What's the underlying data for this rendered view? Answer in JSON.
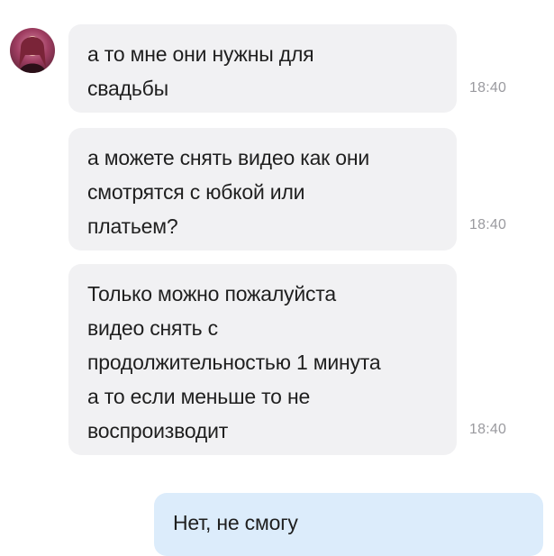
{
  "chat": {
    "incoming": [
      {
        "text": "а то мне они нужны для\nсвадьбы",
        "time": "18:40"
      },
      {
        "text": "а можете снять видео как они\nсмотрятся с юбкой или\nплатьем?",
        "time": "18:40"
      },
      {
        "text": "Только можно пожалуйста\nвидео снять с\nпродолжительностью 1 минута\nа то если меньше то не\nвоспроизводит",
        "time": "18:40"
      }
    ],
    "outgoing": [
      {
        "text": "Нет, не смогу"
      }
    ]
  },
  "colors": {
    "incoming_bubble": "#f1f1f3",
    "outgoing_bubble": "#dcecfb",
    "time_text": "#9a9a9f"
  },
  "icons": {
    "avatar": "user-avatar-photo"
  }
}
